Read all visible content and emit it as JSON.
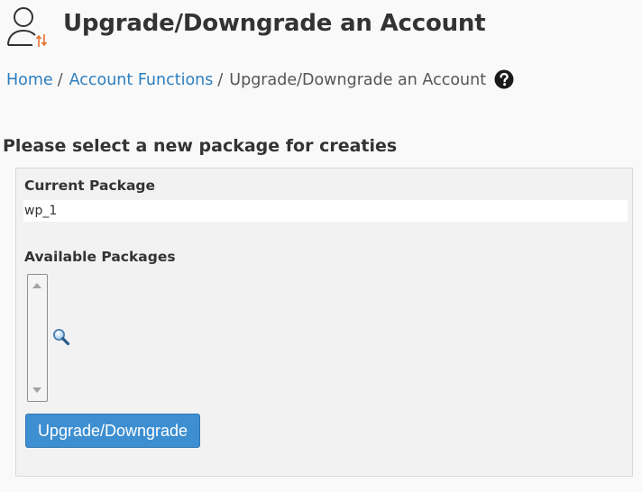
{
  "header": {
    "icon": "user-upgrade-icon",
    "title": "Upgrade/Downgrade an Account"
  },
  "breadcrumb": {
    "items": [
      {
        "label": "Home",
        "separator": "/"
      },
      {
        "label": "Account Functions",
        "separator": "/"
      }
    ],
    "current": "Upgrade/Downgrade an Account",
    "help_icon": "question-circle-icon"
  },
  "form": {
    "heading": "Please select a new package for creaties",
    "current_package_label": "Current Package",
    "current_package_value": "wp_1",
    "available_packages_label": "Available Packages",
    "available_packages_options": [],
    "search_icon": "magnifier-icon",
    "submit_label": "Upgrade/Downgrade"
  },
  "colors": {
    "accent": "#3d8fd1",
    "link": "#2d7fbf",
    "icon_accent": "#e8702a",
    "panel_background": "#f2f2f2",
    "page_background": "#f9f9f9"
  }
}
